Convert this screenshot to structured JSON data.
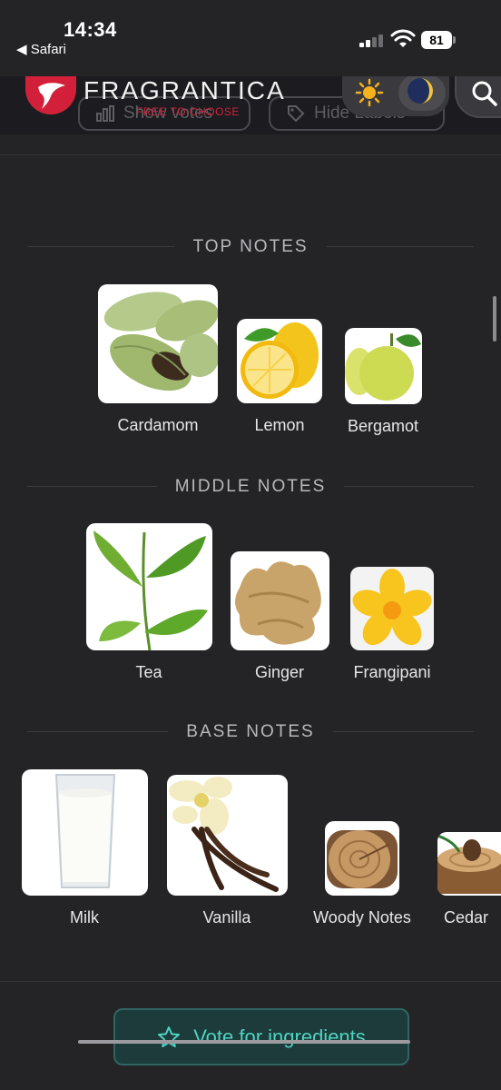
{
  "status_bar": {
    "time": "14:34",
    "back_app": "◀ Safari",
    "battery": "81"
  },
  "header": {
    "logo_text": "FRAGRANTICA",
    "tagline": "FREE TO CHOOSE",
    "show_votes_label": "Show votes",
    "hide_labels_label": "Hide Labels",
    "brand_color": "#d2203a"
  },
  "sections": {
    "top": {
      "title": "TOP NOTES",
      "notes": [
        {
          "label": "Cardamom",
          "icon": "cardamom-image"
        },
        {
          "label": "Lemon",
          "icon": "lemon-image"
        },
        {
          "label": "Bergamot",
          "icon": "bergamot-image"
        }
      ]
    },
    "middle": {
      "title": "MIDDLE NOTES",
      "notes": [
        {
          "label": "Tea",
          "icon": "tea-leaves-image"
        },
        {
          "label": "Ginger",
          "icon": "ginger-image"
        },
        {
          "label": "Frangipani",
          "icon": "frangipani-image"
        }
      ]
    },
    "base": {
      "title": "BASE NOTES",
      "notes": [
        {
          "label": "Milk",
          "icon": "milk-glass-image"
        },
        {
          "label": "Vanilla",
          "icon": "vanilla-image"
        },
        {
          "label": "Woody Notes",
          "icon": "wood-log-image"
        },
        {
          "label": "Cedar",
          "icon": "cedar-image"
        }
      ]
    }
  },
  "vote_button": {
    "label": "Vote for ingredients",
    "accent": "#4fd2c2"
  }
}
